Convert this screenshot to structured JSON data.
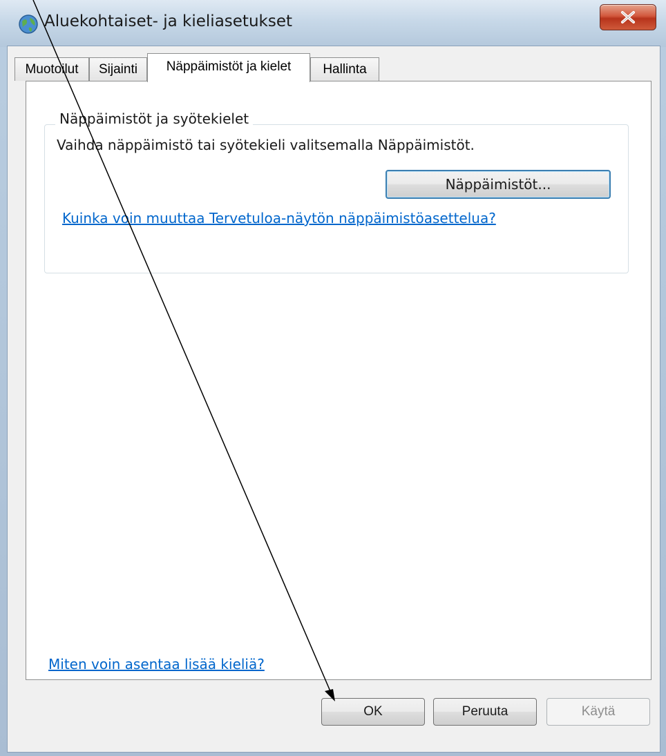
{
  "window": {
    "title": "Aluekohtaiset- ja kieliasetukset",
    "close_icon": "close-icon",
    "app_icon": "globe-icon"
  },
  "tabs": [
    {
      "label": "Muotoilut",
      "active": false
    },
    {
      "label": "Sijainti",
      "active": false
    },
    {
      "label": "Näppäimistöt ja kielet",
      "active": true
    },
    {
      "label": "Hallinta",
      "active": false
    }
  ],
  "keyboards_group": {
    "title": "Näppäimistöt ja syötekielet",
    "description": "Vaihda näppäimistö tai syötekieli valitsemalla Näppäimistöt.",
    "button_label": "Näppäimistöt...",
    "welcome_link": "Kuinka voin muuttaa Tervetuloa-näytön näppäimistöasettelua?"
  },
  "install_link": "Miten voin asentaa lisää kieliä?",
  "buttons": {
    "ok": "OK",
    "cancel": "Peruuta",
    "apply": "Käytä"
  },
  "colors": {
    "link": "#0066cc",
    "close_button": "#c9472b",
    "focus_border": "#3c7fb1"
  }
}
